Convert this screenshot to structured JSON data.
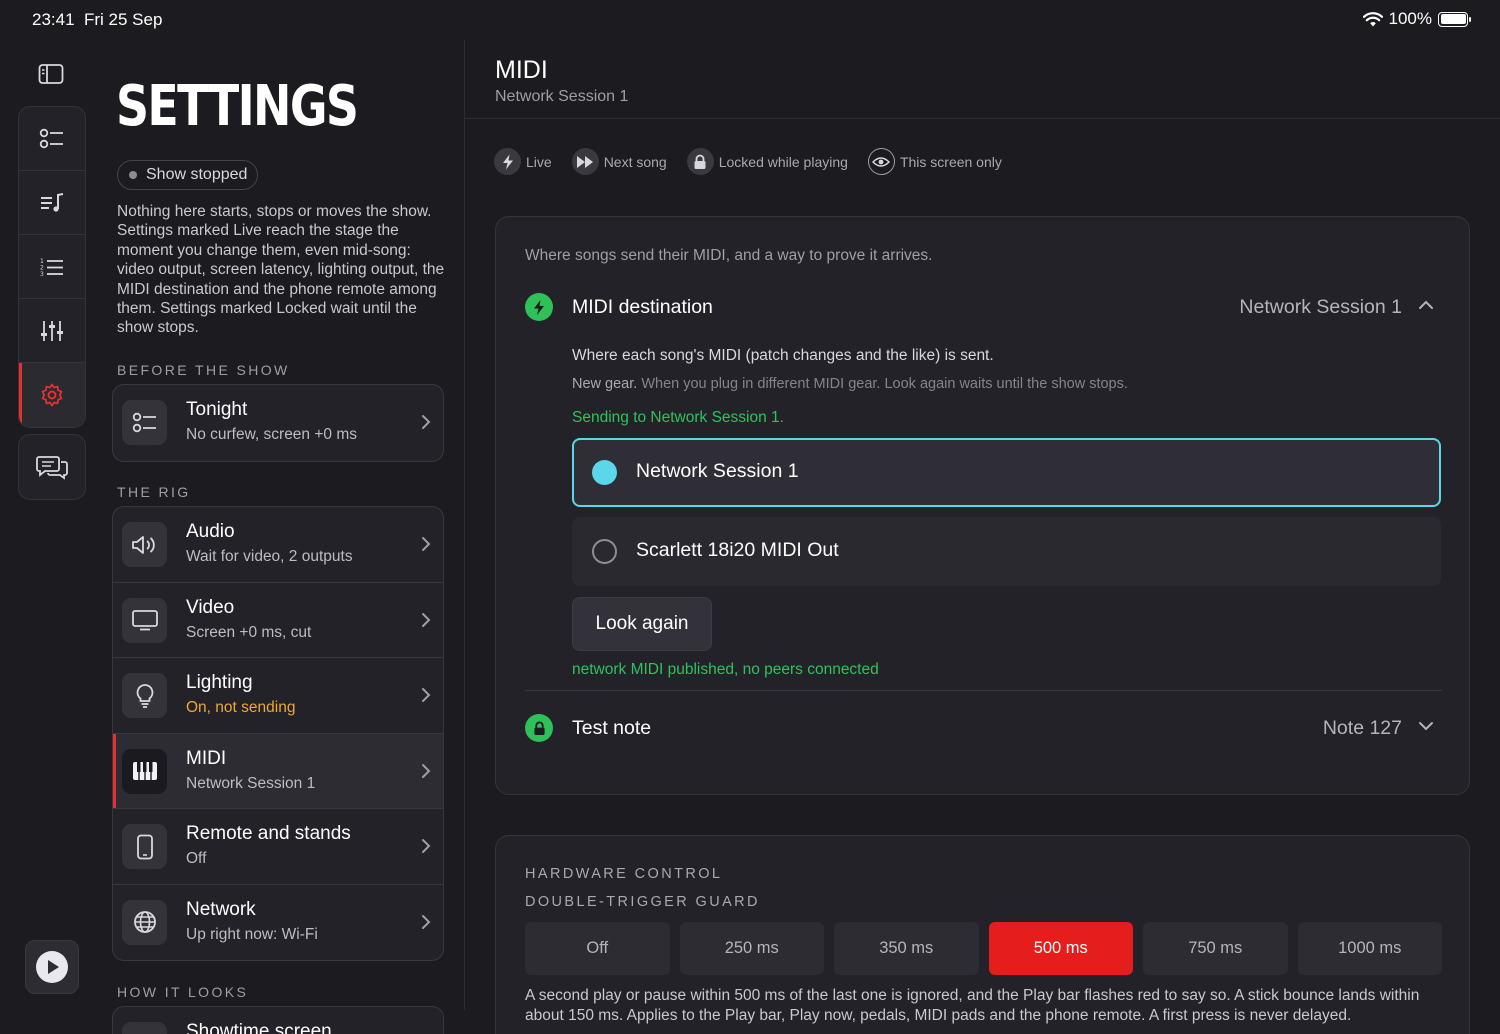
{
  "status_bar": {
    "time": "23:41",
    "date": "Fri 25 Sep",
    "battery": "100%"
  },
  "rail": {
    "icons": [
      "sidebar-toggle-icon",
      "checklist-icon",
      "setlist-icon",
      "numbered-list-icon",
      "mixer-sliders-icon",
      "gear-icon",
      "chat-bubbles-icon",
      "play-icon"
    ],
    "active": "settings"
  },
  "sidebar": {
    "title": "SETTINGS",
    "badge": "Show stopped",
    "intro": "Nothing here starts, stops or moves the show. Settings marked Live reach the stage the moment you change them, even mid-song: video output, screen latency, lighting output, the MIDI destination and the phone remote among them. Settings marked Locked wait until the show stops.",
    "sections": [
      {
        "label": "BEFORE THE SHOW",
        "rows": [
          {
            "title": "Tonight",
            "sub": "No curfew, screen +0 ms"
          }
        ]
      },
      {
        "label": "THE RIG",
        "rows": [
          {
            "title": "Audio",
            "sub": "Wait for video, 2 outputs"
          },
          {
            "title": "Video",
            "sub": "Screen +0 ms, cut"
          },
          {
            "title": "Lighting",
            "sub": "On, not sending"
          },
          {
            "title": "MIDI",
            "sub": "Network Session 1"
          },
          {
            "title": "Remote and stands",
            "sub": "Off"
          },
          {
            "title": "Network",
            "sub": "Up right now: Wi-Fi"
          }
        ]
      },
      {
        "label": "HOW IT LOOKS",
        "rows": [
          {
            "title": "Showtime screen",
            "sub": ""
          }
        ]
      }
    ],
    "warn_color": "#f0a830",
    "active_color": "#e53030"
  },
  "main": {
    "title": "MIDI",
    "subtitle": "Network Session 1",
    "legend": [
      {
        "icon": "lightning-icon",
        "label": "Live"
      },
      {
        "icon": "fast-forward-icon",
        "label": "Next song"
      },
      {
        "icon": "lock-icon",
        "label": "Locked while playing"
      },
      {
        "icon": "eye-icon",
        "label": "This screen only"
      }
    ],
    "panel1": {
      "intro": "Where songs send their MIDI, and a way to prove it arrives.",
      "destination": {
        "name": "MIDI destination",
        "value": "Network Session 1",
        "desc": "Where each song's MIDI (patch changes and the like) is sent.",
        "note_bold": "New gear.",
        "note": " When you plug in different MIDI gear. Look again waits until the show stops.",
        "sending": "Sending to Network Session 1.",
        "options": [
          "Network Session 1",
          "Scarlett 18i20 MIDI Out"
        ],
        "selected": "Network Session 1",
        "look_again": "Look again",
        "net_status": "network MIDI published, no peers connected"
      },
      "test_note": {
        "name": "Test note",
        "value": "Note 127"
      }
    },
    "panel2": {
      "section": "HARDWARE CONTROL",
      "label": "DOUBLE-TRIGGER GUARD",
      "options": [
        "Off",
        "250 ms",
        "350 ms",
        "500 ms",
        "750 ms",
        "1000 ms"
      ],
      "selected": "500 ms",
      "desc": "A second play or pause within 500 ms of the last one is ignored, and the Play bar flashes red to say so. A stick bounce lands within about 150 ms. Applies to the Play bar, Play now, pedals, MIDI pads and the phone remote. A first press is never delayed."
    },
    "colors": {
      "accent_cyan": "#5ad7e8",
      "live_green": "#2ec15a",
      "selected_red": "#e51d1d"
    }
  }
}
